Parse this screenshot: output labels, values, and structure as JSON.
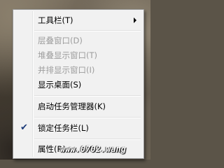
{
  "menu": {
    "toolbars": "工具栏(T)",
    "cascade": "层叠窗口(D)",
    "stacked": "堆叠显示窗口(T)",
    "side_by_side": "并排显示窗口(I)",
    "show_desktop": "显示桌面(S)",
    "task_manager": "启动任务管理器(K)",
    "lock_taskbar": "锁定任务栏(L)",
    "lock_taskbar_checked": true,
    "properties": "属性(R)"
  },
  "watermark": "www.0702.wang",
  "icons": {
    "check": "checkmark-icon",
    "submenu": "chevron-right-icon"
  }
}
